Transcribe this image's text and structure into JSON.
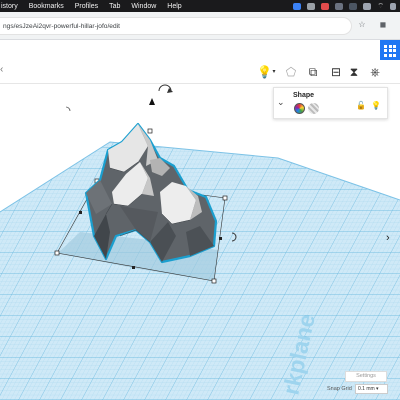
{
  "menubar": {
    "items": [
      "istory",
      "Bookmarks",
      "Profiles",
      "Tab",
      "Window",
      "Help"
    ]
  },
  "browser": {
    "url": "ngs/esJzeAi2qvr-powerful-hillar-jofo/edit"
  },
  "toolbar": {
    "back_glyph": "‹"
  },
  "shape_panel": {
    "title": "Shape",
    "collapse_glyph": "⌄"
  },
  "workplane": {
    "label": "rkplane"
  },
  "bottom": {
    "settings_label": "Settings",
    "snap_grid_label": "Snap Grid",
    "snap_grid_value": "0.1 mm ▾"
  },
  "colors": {
    "grid_fill": "#cfe9f7",
    "grid_line": "#8fcbe8",
    "selection_outline": "#1b9fcf",
    "menubar": "#1a1a1c",
    "apps_button": "#1f77f3"
  },
  "icons": [
    "apple-menu-icon",
    "reload-icon",
    "star-icon",
    "apps-icon",
    "lightbulb-icon",
    "note-icon",
    "group-icon",
    "align-icon",
    "mirror-icon",
    "workplane-icon",
    "lock-icon",
    "rotate-arrow-icon",
    "chevron-right-icon"
  ]
}
